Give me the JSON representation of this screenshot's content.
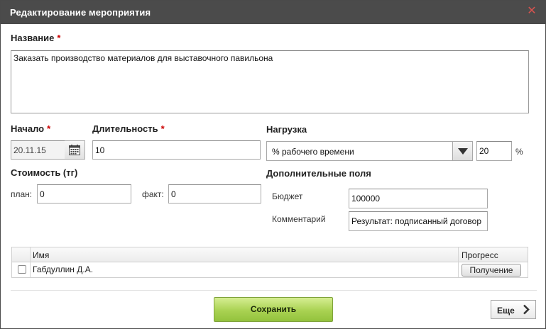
{
  "dialog": {
    "title": "Редактирование мероприятия",
    "close_icon": "close-icon"
  },
  "name_field": {
    "label": "Название",
    "required_mark": "*",
    "value": "Заказать производство материалов для выставочного павильона"
  },
  "start": {
    "label": "Начало",
    "required_mark": "*",
    "value": "20.11.15",
    "icon": "calendar-icon"
  },
  "duration": {
    "label": "Длительность",
    "required_mark": "*",
    "value": "10"
  },
  "load": {
    "label": "Нагрузка",
    "selected": "% рабочего времени",
    "value": "20",
    "unit": "%"
  },
  "cost": {
    "label": "Стоимость (тг)",
    "plan_label": "план:",
    "plan_value": "0",
    "fact_label": "факт:",
    "fact_value": "0"
  },
  "extra": {
    "label": "Дополнительные поля",
    "budget_label": "Бюджет",
    "budget_value": "100000",
    "comment_label": "Комментарий",
    "comment_value": "Результат: подписанный договор"
  },
  "table": {
    "columns": [
      "Имя",
      "Прогресс"
    ],
    "rows": [
      {
        "name": "Габдуллин Д.А.",
        "progress": "Получение",
        "checked": false
      }
    ]
  },
  "footer": {
    "save_label": "Сохранить",
    "more_label": "Еще"
  },
  "colors": {
    "titlebar": "#4b4b4b",
    "required": "#cc0000",
    "close": "#d9534f",
    "save_button": "#a9d252"
  }
}
